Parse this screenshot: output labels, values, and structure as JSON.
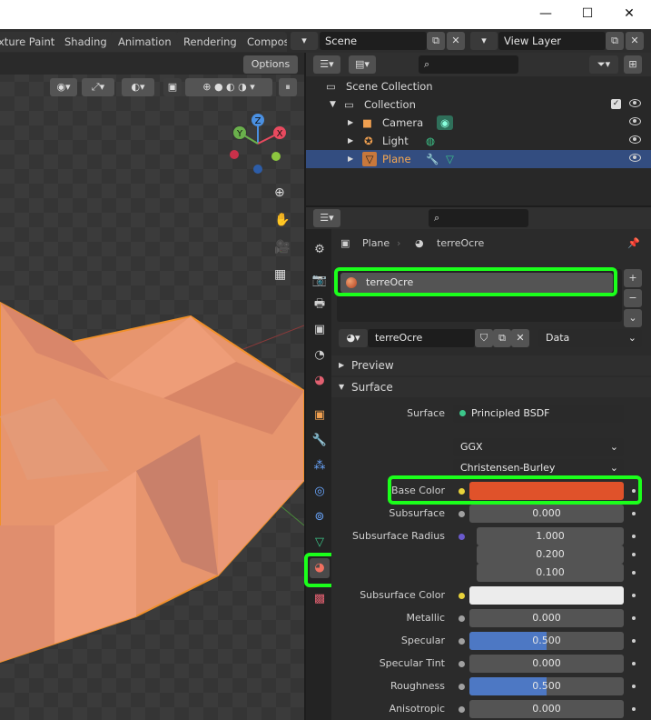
{
  "window": {
    "minimize_glyph": "—",
    "maximize_glyph": "☐",
    "close_glyph": "✕"
  },
  "workspaces": {
    "tabs": [
      "xture Paint",
      "Shading",
      "Animation",
      "Rendering",
      "Compos"
    ]
  },
  "scene": {
    "value": "Scene"
  },
  "view_layer": {
    "value": "View Layer"
  },
  "viewport": {
    "options_label": "Options",
    "gizmo": {
      "x": "X",
      "y": "Y",
      "z": "Z"
    }
  },
  "outliner": {
    "items": [
      {
        "label": "Scene Collection"
      },
      {
        "label": "Collection"
      },
      {
        "label": "Camera"
      },
      {
        "label": "Light"
      },
      {
        "label": "Plane"
      }
    ]
  },
  "properties": {
    "breadcrumb": {
      "object": "Plane",
      "material": "terreOcre"
    },
    "slot_name": "terreOcre",
    "material_name": "terreOcre",
    "link_mode": "Data",
    "panels": {
      "preview": "Preview",
      "surface": "Surface"
    },
    "surface": {
      "surface_label": "Surface",
      "surface_value": "Principled BSDF",
      "distribution": "GGX",
      "subsurface_method": "Christensen-Burley",
      "rows": [
        {
          "label": "Base Color",
          "value": ""
        },
        {
          "label": "Subsurface",
          "value": "0.000"
        },
        {
          "label": "Subsurface Radius",
          "value": "1.000"
        },
        {
          "label": "",
          "value": "0.200"
        },
        {
          "label": "",
          "value": "0.100"
        },
        {
          "label": "Subsurface Color",
          "value": ""
        },
        {
          "label": "Metallic",
          "value": "0.000"
        },
        {
          "label": "Specular",
          "value": "0.500"
        },
        {
          "label": "Specular Tint",
          "value": "0.000"
        },
        {
          "label": "Roughness",
          "value": "0.500"
        },
        {
          "label": "Anisotropic",
          "value": "0.000"
        }
      ],
      "specular_fill": 0.5,
      "roughness_fill": 0.5
    },
    "colors": {
      "base_color": "#e0522a",
      "subsurface_color": "#ececec",
      "highlight": "#1bff1b",
      "selection": "#334d80",
      "slider_fill": "#4d78c4"
    }
  }
}
